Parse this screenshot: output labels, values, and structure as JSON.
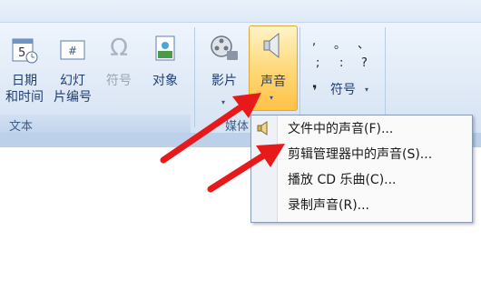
{
  "ribbon": {
    "group_text_label": "文本",
    "group_media_label_partial": "媒体",
    "buttons": {
      "datetime_line1": "日期",
      "datetime_line2": "和时间",
      "slide_number_line1": "幻灯",
      "slide_number_line2": "片编号",
      "symbol": "符号",
      "object": "对象",
      "movie": "影片",
      "sound": "声音",
      "symbol_gallery": "符号"
    },
    "symbols": [
      ",",
      "。",
      "、",
      ";",
      ":",
      "?",
      "❜"
    ]
  },
  "sound_menu": {
    "items": [
      {
        "label": "文件中的声音(F)..."
      },
      {
        "label": "剪辑管理器中的声音(S)..."
      },
      {
        "label": "播放 CD 乐曲(C)..."
      },
      {
        "label": "录制声音(R)..."
      }
    ]
  },
  "colors": {
    "ribbon_text": "#1f3e74",
    "pressed": "#ffd97a",
    "arrow": "#e8191b"
  }
}
